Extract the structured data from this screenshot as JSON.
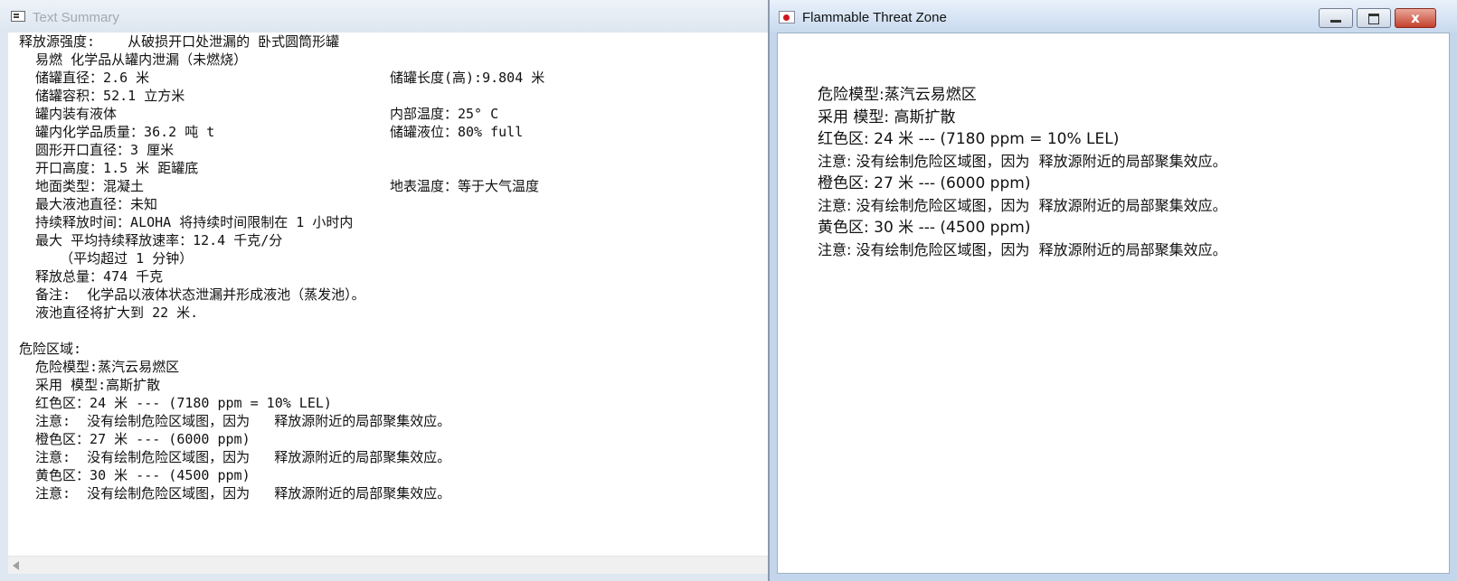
{
  "left_window": {
    "title": "Text Summary",
    "lines": [
      {
        "text": "释放源强度:    从破损开口处泄漏的 卧式圆筒形罐",
        "col2": ""
      },
      {
        "text": "  易燃 化学品从罐内泄漏（未燃烧）",
        "col2": ""
      },
      {
        "text": "  储罐直径：2.6 米",
        "col2": "储罐长度(高):9.804 米"
      },
      {
        "text": "  储罐容积：52.1 立方米",
        "col2": ""
      },
      {
        "text": "  罐内装有液体",
        "col2": "内部温度：25° C"
      },
      {
        "text": "  罐内化学品质量：36.2 吨 t",
        "col2": "储罐液位：80% full"
      },
      {
        "text": "  圆形开口直径：3 厘米",
        "col2": ""
      },
      {
        "text": "  开口高度：1.5 米 距罐底",
        "col2": ""
      },
      {
        "text": "  地面类型：混凝土",
        "col2": "地表温度：等于大气温度"
      },
      {
        "text": "  最大液池直径：未知",
        "col2": ""
      },
      {
        "text": "  持续释放时间：ALOHA 将持续时间限制在 1 小时内",
        "col2": ""
      },
      {
        "text": "  最大 平均持续释放速率：12.4 千克/分",
        "col2": ""
      },
      {
        "text": "     （平均超过 1 分钟）",
        "col2": ""
      },
      {
        "text": "  释放总量：474 千克",
        "col2": ""
      },
      {
        "text": "  备注:  化学品以液体状态泄漏并形成液池（蒸发池）。",
        "col2": ""
      },
      {
        "text": "  液池直径将扩大到 22 米.",
        "col2": ""
      },
      {
        "text": "",
        "col2": ""
      },
      {
        "text": "危险区域:",
        "col2": ""
      },
      {
        "text": "  危险模型:蒸汽云易燃区",
        "col2": ""
      },
      {
        "text": "  采用 模型:高斯扩散",
        "col2": ""
      },
      {
        "text": "  红色区：24 米 --- (7180 ppm = 10% LEL)",
        "col2": ""
      },
      {
        "text": "  注意:  没有绘制危险区域图，因为   释放源附近的局部聚集效应。",
        "col2": ""
      },
      {
        "text": "  橙色区：27 米 --- (6000 ppm)",
        "col2": ""
      },
      {
        "text": "  注意:  没有绘制危险区域图，因为   释放源附近的局部聚集效应。",
        "col2": ""
      },
      {
        "text": "  黄色区：30 米 --- (4500 ppm)",
        "col2": ""
      },
      {
        "text": "  注意:  没有绘制危险区域图，因为   释放源附近的局部聚集效应。",
        "col2": ""
      }
    ]
  },
  "right_window": {
    "title": "Flammable Threat Zone",
    "close_glyph": "x",
    "lines": [
      "危险模型:蒸汽云易燃区",
      "采用 模型: 高斯扩散",
      "红色区: 24 米 --- (7180 ppm = 10% LEL)",
      "注意: 没有绘制危险区域图，因为  释放源附近的局部聚集效应。",
      "橙色区: 27 米 --- (6000 ppm)",
      "注意: 没有绘制危险区域图，因为  释放源附近的局部聚集效应。",
      "黄色区: 30 米 --- (4500 ppm)",
      "注意: 没有绘制危险区域图，因为  释放源附近的局部聚集效应。"
    ]
  }
}
